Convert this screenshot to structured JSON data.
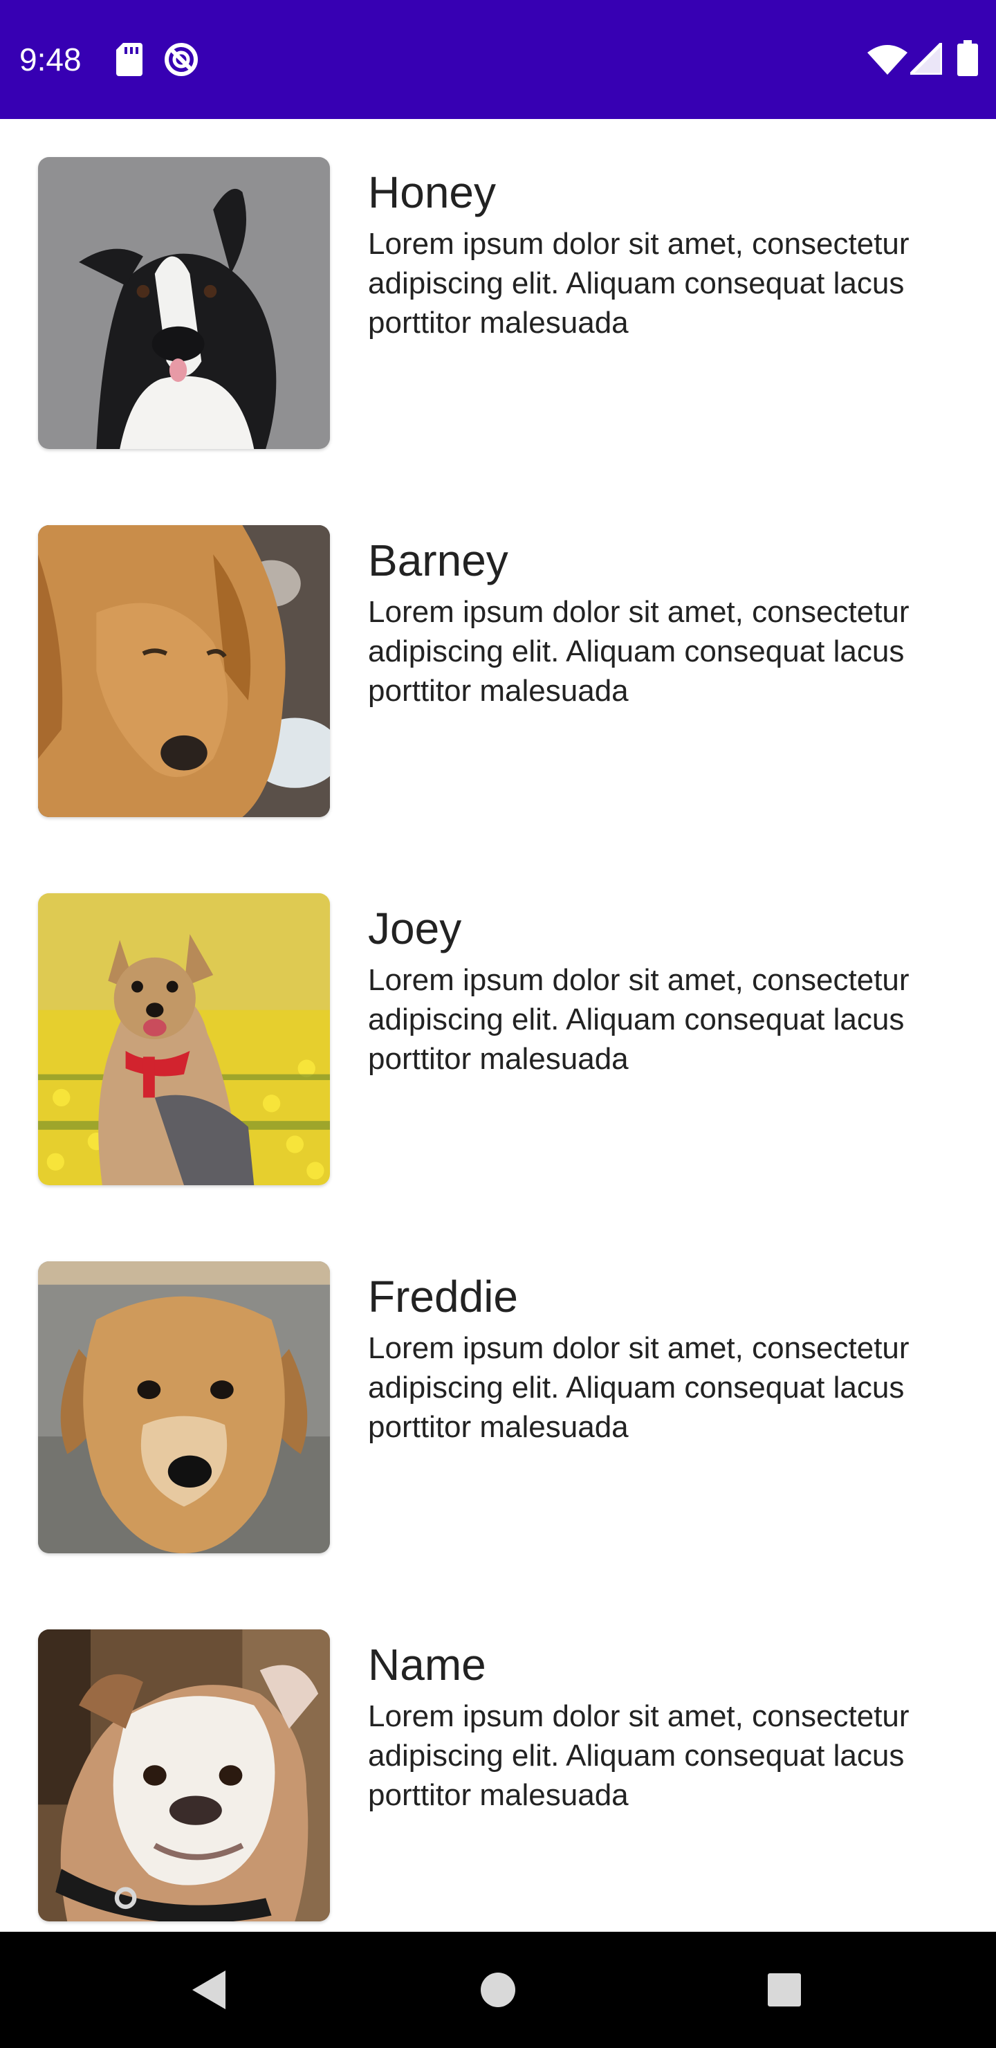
{
  "status_bar": {
    "time": "9:48",
    "background": "#3700B3",
    "icons": [
      "sd-card-icon",
      "do-not-disturb-icon",
      "wifi-icon",
      "signal-icon",
      "battery-icon"
    ]
  },
  "dogs": [
    {
      "name": "Honey",
      "description": "Lorem ipsum dolor sit amet, consectetur adipiscing elit. Aliquam consequat lacus porttitor malesuada",
      "photo": "border-collie-photo"
    },
    {
      "name": "Barney",
      "description": "Lorem ipsum dolor sit amet, consectetur adipiscing elit. Aliquam consequat lacus porttitor malesuada",
      "photo": "golden-retriever-photo"
    },
    {
      "name": "Joey",
      "description": "Lorem ipsum dolor sit amet, consectetur adipiscing elit. Aliquam consequat lacus porttitor malesuada",
      "photo": "yorkshire-terrier-photo"
    },
    {
      "name": "Freddie",
      "description": "Lorem ipsum dolor sit amet, consectetur adipiscing elit. Aliquam consequat lacus porttitor malesuada",
      "photo": "mixed-breed-puppy-photo"
    },
    {
      "name": "Name",
      "description": "Lorem ipsum dolor sit amet, consectetur adipiscing elit. Aliquam consequat lacus porttitor malesuada",
      "photo": "bulldog-photo"
    }
  ],
  "nav_bar": {
    "buttons": [
      "back-icon",
      "home-icon",
      "recents-icon"
    ]
  }
}
